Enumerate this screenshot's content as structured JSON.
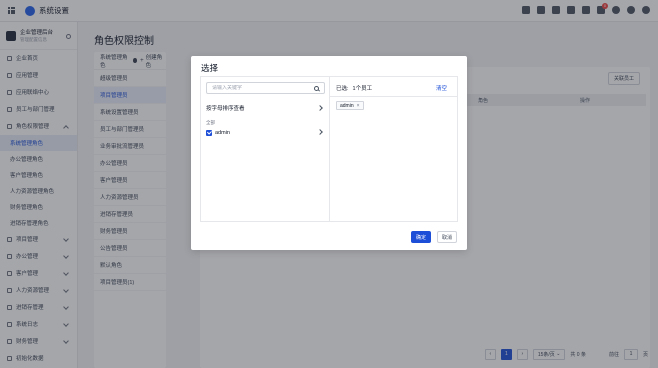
{
  "topbar": {
    "app_title": "系统设置",
    "tools": [
      "checkbox-icon",
      "user-icon",
      "document-icon",
      "calendar-icon",
      "mail-icon",
      "bell-icon",
      "help-icon",
      "settings-icon",
      "avatar"
    ],
    "notification_count": "0"
  },
  "sidebar": {
    "company_name": "企业管理后台",
    "company_sub": "管理配置信息",
    "nav_top": [
      {
        "label": "企业首页",
        "icon": "home-icon"
      },
      {
        "label": "应用管理",
        "icon": "apps-icon"
      },
      {
        "label": "应用联络中心",
        "icon": "contact-icon"
      },
      {
        "label": "员工与部门管理",
        "icon": "staff-icon"
      }
    ],
    "roles_group": {
      "label": "角色权限管理",
      "icon": "shield-icon"
    },
    "role_children": [
      "系统管理角色",
      "办公管理角色",
      "客户管理角色",
      "人力资源管理角色",
      "财务管理角色",
      "进销存管理角色"
    ],
    "nav_bottom": [
      {
        "label": "项目管理",
        "icon": "project-icon"
      },
      {
        "label": "办公管理",
        "icon": "office-icon"
      },
      {
        "label": "客户管理",
        "icon": "customer-icon"
      },
      {
        "label": "人力资源管理",
        "icon": "hr-icon"
      },
      {
        "label": "进销存管理",
        "icon": "inventory-icon"
      },
      {
        "label": "系统日志",
        "icon": "log-icon"
      },
      {
        "label": "财务管理",
        "icon": "finance-icon"
      },
      {
        "label": "初始化数据",
        "icon": "database-icon"
      }
    ]
  },
  "main": {
    "page_title": "角色权限控制",
    "roles_panel": {
      "header": "系统管理角色",
      "create_label": "创建角色",
      "items": [
        "超级管理员",
        "项目管理员",
        "系统设置管理员",
        "员工与部门管理员",
        "业务审批流管理员",
        "办公管理员",
        "客户管理员",
        "人力资源管理员",
        "进销存管理员",
        "财务管理员",
        "公告管理员",
        "默认角色",
        "项目管理员(1)"
      ]
    },
    "add_staff_button": "关联员工",
    "table_headers": [
      "角色",
      "操作"
    ],
    "pagination": {
      "page": "1",
      "page_size": "15条/页",
      "total": "共 0 条",
      "goto_label": "前往",
      "goto_value": "1",
      "page_suffix": "页"
    }
  },
  "modal": {
    "title": "选择",
    "search_placeholder": "请输入关键字",
    "sort_label": "按字母排序查看",
    "group_label": "全部",
    "user": "admin",
    "selected_label": "已选:",
    "selected_count": "1个员工",
    "clear_label": "清空",
    "tag": "admin",
    "ok_label": "确定",
    "cancel_label": "取消"
  },
  "colors": {
    "primary": "#1d4ed8",
    "overlay": "#282c34",
    "sidebar_active_bg": "#e5edf8"
  }
}
